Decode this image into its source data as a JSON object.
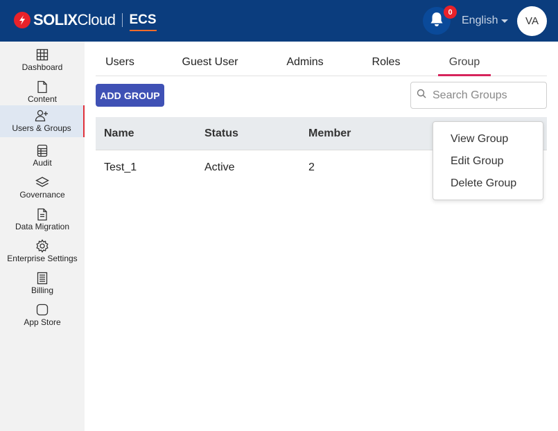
{
  "header": {
    "brand_bold": "SOLIX",
    "brand_light": "Cloud",
    "product": "ECS",
    "notification_count": "0",
    "language": "English",
    "avatar_initials": "VA",
    "colors": {
      "header_bg": "#0b3d7e",
      "brand_red": "#e8222a",
      "accent_orange": "#f26c2a"
    }
  },
  "sidebar": {
    "items": [
      {
        "label": "Dashboard",
        "icon": "grid-icon"
      },
      {
        "label": "Content",
        "icon": "file-icon"
      },
      {
        "label": "Users & Groups",
        "icon": "user-add-icon",
        "active": true
      },
      {
        "label": "Audit",
        "icon": "ledger-icon"
      },
      {
        "label": "Governance",
        "icon": "layers-icon"
      },
      {
        "label": "Data Migration",
        "icon": "document-icon"
      },
      {
        "label": "Enterprise Settings",
        "icon": "gear-icon"
      },
      {
        "label": "Billing",
        "icon": "invoice-icon"
      },
      {
        "label": "App Store",
        "icon": "square-icon"
      }
    ]
  },
  "tabs": [
    {
      "label": "Users"
    },
    {
      "label": "Guest User"
    },
    {
      "label": "Admins"
    },
    {
      "label": "Roles"
    },
    {
      "label": "Group",
      "active": true
    }
  ],
  "toolbar": {
    "add_label": "ADD GROUP",
    "search_placeholder": "Search Groups",
    "button_color": "#3f51b5"
  },
  "table": {
    "columns": [
      "Name",
      "Status",
      "Member"
    ],
    "rows": [
      {
        "name": "Test_1",
        "status": "Active",
        "member": "2"
      }
    ]
  },
  "context_menu": {
    "items": [
      "View Group",
      "Edit Group",
      "Delete Group"
    ]
  }
}
